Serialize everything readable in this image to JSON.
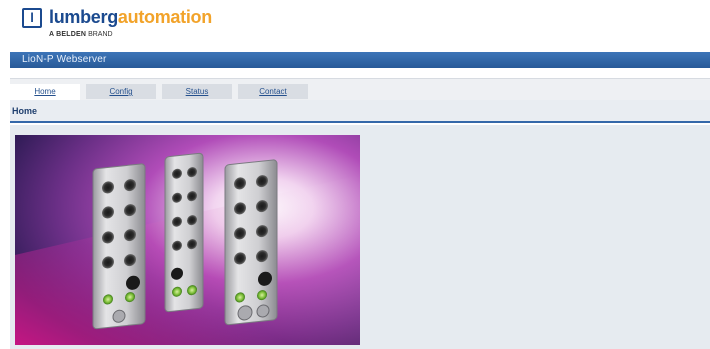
{
  "header": {
    "logo_mark": "l",
    "brand_primary": "lumberg",
    "brand_secondary": "automation",
    "brand_tagline_strong": "A BELDEN",
    "brand_tagline_rest": "BRAND"
  },
  "titlebar": {
    "title": "LioN-P Webserver"
  },
  "tabs": [
    {
      "label": "Home",
      "active": true
    },
    {
      "label": "Config",
      "active": false
    },
    {
      "label": "Status",
      "active": false
    },
    {
      "label": "Contact",
      "active": false
    }
  ],
  "section": {
    "title": "Home"
  },
  "hero": {
    "description_icon": "product-photo-icon"
  },
  "colors": {
    "brand_blue": "#1b4a8f",
    "brand_orange": "#f2a32a",
    "titlebar": "#3468a9",
    "tab_bg": "#d9dde3",
    "content_bg": "#e6ebf0"
  }
}
